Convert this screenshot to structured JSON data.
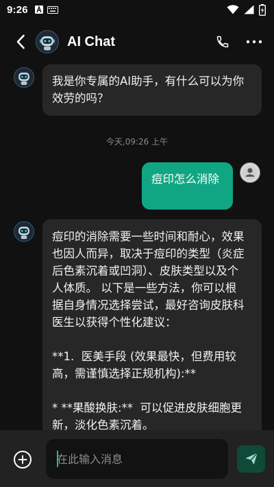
{
  "status_bar": {
    "time": "9:26"
  },
  "header": {
    "title": "AI Chat"
  },
  "messages": [
    {
      "role": "ai",
      "text": "我是你专属的AI助手，有什么可以为你\n效劳的吗？"
    },
    {
      "role": "timestamp",
      "text": "今天,09:26 上午"
    },
    {
      "role": "me",
      "text": "痘印怎么消除"
    },
    {
      "role": "ai",
      "text": "痘印的消除需要一些时间和耐心，效果\n也因人而异，取决于痘印的类型（炎症\n后色素沉着或凹洞）、皮肤类型以及个\n人体质。 以下是一些方法，你可以根\n据自身情况选择尝试，最好咨询皮肤科\n医生以获得个性化建议：\n\n**1.  医美手段 (效果最快，但费用较\n高，需谨慎选择正规机构):**\n\n* **果酸换肤:**  可以促进皮肤细胞更\n新，淡化色素沉着。\n* **激光治疗:**  不同的激光针对不同\n类型的痘印。"
    }
  ],
  "input": {
    "placeholder": "在此输入消息"
  },
  "colors": {
    "accent": "#11a683",
    "send_bg": "#0f4a39",
    "ai_bubble": "#272727",
    "background": "#111111"
  }
}
